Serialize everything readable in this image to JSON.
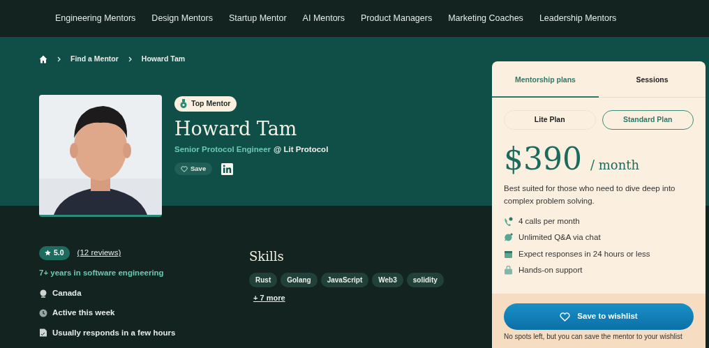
{
  "nav": {
    "items": [
      "Engineering Mentors",
      "Design Mentors",
      "Startup Mentor",
      "AI Mentors",
      "Product Managers",
      "Marketing Coaches",
      "Leadership Mentors"
    ]
  },
  "breadcrumb": [
    "Find a Mentor",
    "Howard Tam"
  ],
  "profile": {
    "badge": "Top Mentor",
    "name": "Howard Tam",
    "role": "Senior Protocol Engineer",
    "company": "@ Lit Protocol",
    "save": "Save"
  },
  "summary": {
    "rating": "5.0",
    "reviews": "(12 reviews)",
    "experience": "7+ years in software engineering",
    "facts": [
      {
        "kind": "location",
        "text": "Canada"
      },
      {
        "kind": "activity",
        "text": "Active this week"
      },
      {
        "kind": "response",
        "text": "Usually responds in a few hours"
      }
    ]
  },
  "skills": {
    "title": "Skills",
    "tags": [
      "Rust",
      "Golang",
      "JavaScript",
      "Web3",
      "solidity"
    ],
    "more": "+ 7 more"
  },
  "plan_card": {
    "tabs": [
      {
        "label": "Mentorship plans",
        "selected": true
      },
      {
        "label": "Sessions",
        "selected": false
      }
    ],
    "plans": [
      {
        "label": "Lite Plan",
        "selected": false
      },
      {
        "label": "Standard Plan",
        "selected": true
      }
    ],
    "price": "$390",
    "period": "/ month",
    "description": "Best suited for those who need to dive deep into complex problem solving.",
    "features": [
      {
        "kind": "calls",
        "text": "4 calls per month"
      },
      {
        "kind": "chat",
        "text": "Unlimited Q&A via chat"
      },
      {
        "kind": "calendar",
        "text": "Expect responses in 24 hours or less"
      },
      {
        "kind": "support",
        "text": "Hands-on support"
      }
    ],
    "wishlist_button": "Save to wishlist",
    "note": "No spots left, but you can save the mentor to your wishlist"
  }
}
